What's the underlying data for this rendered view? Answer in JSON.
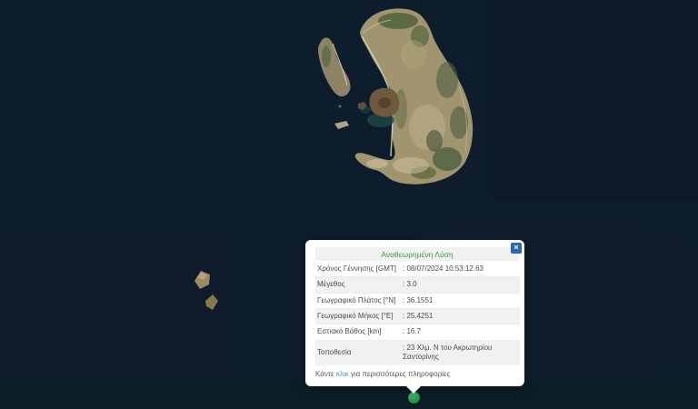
{
  "map": {
    "description": "satellite-map-of-santorini-caldera",
    "colors": {
      "sea": "#0e1d2c",
      "sea_bottom_band": "#0c1d26",
      "land_tan": "#a1956f",
      "land_green": "#55663f",
      "caldera_shallow_teal": "#1d4a44",
      "marker_green": "#2e9c52"
    },
    "marker": {
      "name": "earthquake-epicenter",
      "shape": "circle"
    }
  },
  "popup": {
    "title": "Αναθεωρημένη Λύση",
    "title_color": "#3f9b41",
    "close_label": "×",
    "close_button_color": "#2d66b3",
    "row_alt_color": "#f1f1f1",
    "rows": [
      {
        "label": "Χρόνος Γέννησης [GMT]",
        "value": ": 08/07/2024 10:53:12.63"
      },
      {
        "label": "Μέγεθος",
        "value": ": 3.0"
      },
      {
        "label": "Γεωγραφικό Πλάτος [°N]",
        "value": ": 36.1551"
      },
      {
        "label": "Γεωγραφικό Μήκος [°E]",
        "value": ": 25.4251"
      },
      {
        "label": "Εστιακό Βάθος [km]",
        "value": ": 16.7"
      },
      {
        "label": "Τοποθεσία",
        "value": ": 23 Χλμ. N του Ακρωτηρίου Σαντορίνης"
      }
    ],
    "footer": {
      "before_link": "Κάντε ",
      "link": "κλικ",
      "after_link": " για περισσότερες πληροφορίες",
      "link_color": "#3a9fc4"
    }
  }
}
